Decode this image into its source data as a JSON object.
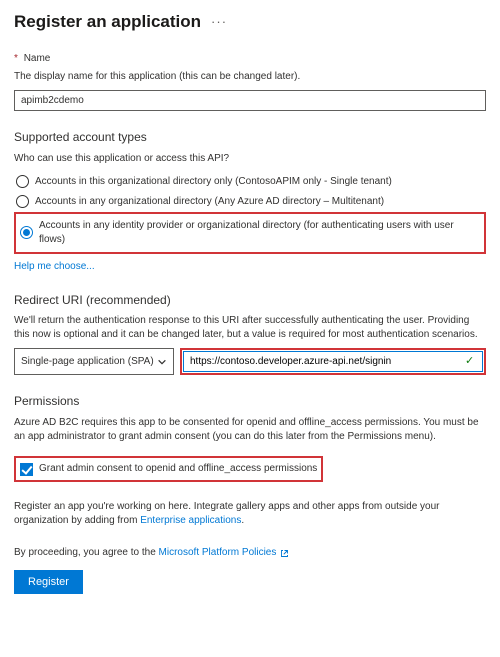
{
  "header": {
    "title": "Register an application"
  },
  "name_section": {
    "label": "Name",
    "helper": "The display name for this application (this can be changed later).",
    "value": "apimb2cdemo"
  },
  "account_types": {
    "heading": "Supported account types",
    "helper": "Who can use this application or access this API?",
    "options": [
      "Accounts in this organizational directory only (ContosoAPIM only - Single tenant)",
      "Accounts in any organizational directory (Any Azure AD directory – Multitenant)",
      "Accounts in any identity provider or organizational directory (for authenticating users with user flows)"
    ],
    "selected_index": 2,
    "help_link": "Help me choose..."
  },
  "redirect": {
    "heading": "Redirect URI (recommended)",
    "helper": "We'll return the authentication response to this URI after successfully authenticating the user. Providing this now is optional and it can be changed later, but a value is required for most authentication scenarios.",
    "platform": "Single-page application (SPA)",
    "url": "https://contoso.developer.azure-api.net/signin"
  },
  "permissions": {
    "heading": "Permissions",
    "helper": "Azure AD B2C requires this app to be consented for openid and offline_access permissions. You must be an app administrator to grant admin consent (you can do this later from the Permissions menu).",
    "checkbox_label": "Grant admin consent to openid and offline_access permissions",
    "checked": true
  },
  "footer": {
    "note_prefix": "Register an app you're working on here. Integrate gallery apps and other apps from outside your organization by adding from ",
    "note_link": "Enterprise applications",
    "note_suffix": ".",
    "policy_prefix": "By proceeding, you agree to the ",
    "policy_link": "Microsoft Platform Policies",
    "register_button": "Register"
  }
}
